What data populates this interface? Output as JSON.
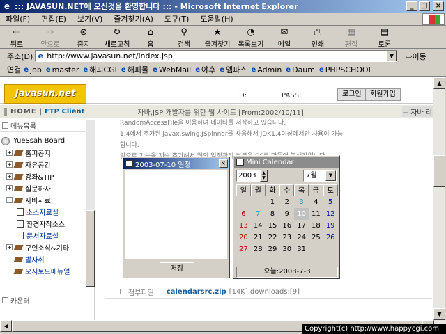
{
  "window": {
    "title": "::: JAVASUN.NET에 오신것을 환영합니다 ::: - Microsoft Internet Explorer"
  },
  "menu": [
    "파일(F)",
    "편집(E)",
    "보기(V)",
    "즐겨찾기(A)",
    "도구(T)",
    "도움말(H)"
  ],
  "toolbar": {
    "back": "뒤로",
    "forward": "앞으로",
    "stop": "중지",
    "refresh": "새로고침",
    "home": "홈",
    "search": "검색",
    "favorites": "즐겨찾기",
    "history": "목록보기",
    "mail": "메일",
    "print": "인쇄",
    "edit": "편집",
    "discuss": "토론"
  },
  "address": {
    "label": "주소(D)",
    "url": "http://www.javasun.net/index.jsp",
    "go": "이동"
  },
  "links": {
    "label": "연결",
    "items": [
      "job",
      "master",
      "해피CGI",
      "해피몰",
      "WebMail",
      "야후",
      "엠파스",
      "Admin",
      "Daum",
      "PHPSCHOOL"
    ]
  },
  "site": {
    "logo": "Javasun.net",
    "id_label": "ID:",
    "pass_label": "PASS:",
    "login_button": "로그인",
    "join_button": "회원가입",
    "nav_home": "HOME",
    "nav_ftp": "FTP Client",
    "tagline": "자바,JSP 개발자를 위한 웹 사이트   [From:2002/10/11]",
    "marquee": "-- 자바 리",
    "sidebar_head": "메뉴목록",
    "sidebar_foot": "카운터",
    "tree": [
      {
        "label": "YueSsah Board",
        "level": 0
      },
      {
        "label": "홈피공지",
        "level": 1
      },
      {
        "label": "자유공간",
        "level": 1
      },
      {
        "label": "강좌&TIP",
        "level": 1
      },
      {
        "label": "질문하자",
        "level": 1
      },
      {
        "label": "자바자료",
        "level": 1
      },
      {
        "label": "소스자료실",
        "level": 2
      },
      {
        "label": "환경자작소스",
        "level": 2
      },
      {
        "label": "문서자료실",
        "level": 2
      },
      {
        "label": "구인소식&기타",
        "level": 1
      },
      {
        "label": "발자취",
        "level": 1
      },
      {
        "label": "오시보드메뉴얼",
        "level": 1
      }
    ],
    "article_lines": [
      "RandomAccessFile을 이용하여 데이타를 저장하고 있습니다.",
      "1.4에서 추가된 javax.swing.JSpinner를 사용해서 JDK1.4이상에서만 사용이 가능합니다.",
      "앞으로 기능을 계속 추가해서 웹의 일정관리 부분을 CS로 만들어 볼생각입니다."
    ],
    "attach_label": "첨부파일",
    "attach_file": "calendarsrc.zip",
    "attach_size": "[14K] downloads:[9]"
  },
  "memo_window": {
    "title": "2003-07-10 일정",
    "save_button": "저장"
  },
  "calendar_window": {
    "title": "Mini Calendar",
    "year": "2003",
    "month": "7월",
    "weekdays": [
      "일",
      "월",
      "화",
      "수",
      "목",
      "금",
      "토"
    ],
    "weeks": [
      [
        "",
        "",
        "1",
        "2",
        "3",
        "4",
        "5"
      ],
      [
        "6",
        "7",
        "8",
        "9",
        "10",
        "11",
        "12"
      ],
      [
        "13",
        "14",
        "15",
        "16",
        "17",
        "18",
        "19"
      ],
      [
        "20",
        "21",
        "22",
        "23",
        "24",
        "25",
        "26"
      ],
      [
        "27",
        "28",
        "29",
        "30",
        "31",
        "",
        ""
      ]
    ],
    "selected_day": "10",
    "highlight_days": [
      "3",
      "7"
    ],
    "today_text": "오늘:2003-7-3"
  },
  "copyright": "Copyright(c) http://www.happycgi.com"
}
